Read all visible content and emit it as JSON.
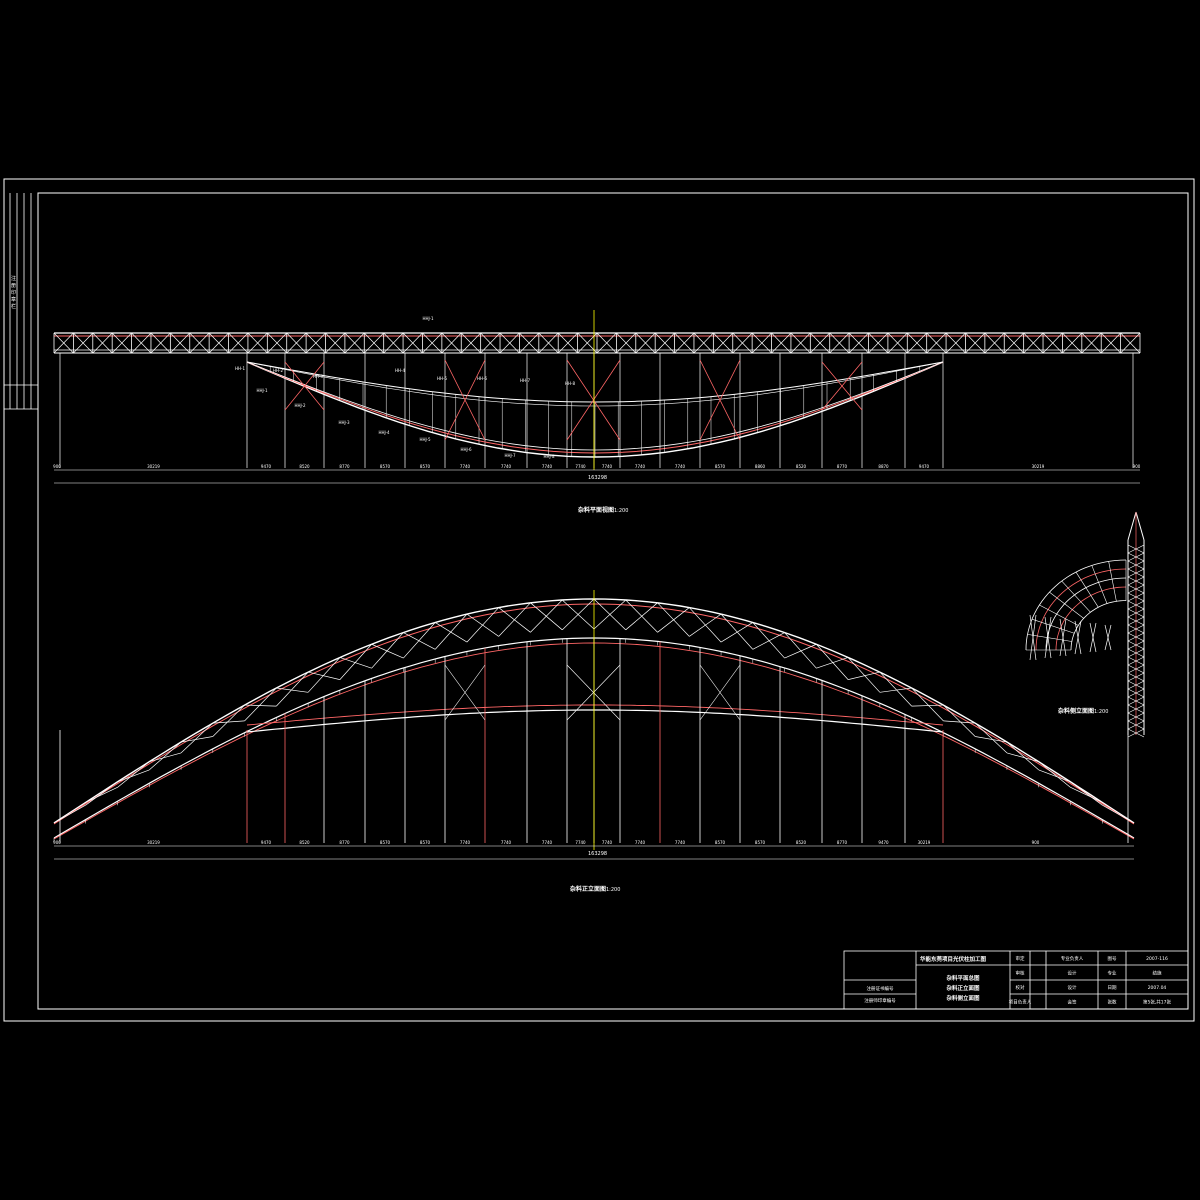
{
  "colors": {
    "background": "#000000",
    "line": "#ffffff",
    "chord": "#ff6666",
    "axis": "#ffff00"
  },
  "top_view": {
    "member_labels": [
      "HHJ-1",
      "HH-1",
      "HHJ-1",
      "HHJ-2",
      "HHJ-3",
      "HHJ-4",
      "HHJ-5",
      "HHJ-6",
      "HHJ-7",
      "HHJ-8",
      "HH-2",
      "HH-3",
      "HH-4",
      "HH-5",
      "HH-6",
      "HH-7",
      "HH-8"
    ],
    "dims": [
      "900",
      "30219",
      "9470",
      "8520",
      "8770",
      "8570",
      "8570",
      "7740",
      "7740",
      "7740",
      "7740",
      "7740",
      "7740",
      "7740",
      "8570",
      "8860",
      "8520",
      "8770",
      "8870",
      "9470",
      "30219",
      "900"
    ],
    "total": "163298",
    "title": "杂料平面视图",
    "scale": "1:200"
  },
  "front_view": {
    "dims": [
      "900",
      "30219",
      "9470",
      "8520",
      "8770",
      "8570",
      "8570",
      "7740",
      "7740",
      "7740",
      "7740",
      "7740",
      "7740",
      "7740",
      "8570",
      "8570",
      "8520",
      "8770",
      "9470",
      "30219",
      "900"
    ],
    "total": "163298",
    "title": "杂料正立面图",
    "scale": "1:200"
  },
  "side_view": {
    "title": "杂料侧立面图",
    "scale": "1:200"
  },
  "left_strip": {
    "labels": [
      "注",
      "册",
      "印",
      "章",
      "栏"
    ]
  },
  "title_block": {
    "project": "华能东莞项目光伏柱加工图",
    "drawing_titles": [
      "杂料平面总图",
      "杂料正立面图",
      "杂料侧立面图"
    ],
    "roles": [
      "审定",
      "审核",
      "校对",
      "项目负责人"
    ],
    "roles2": [
      "专业负责人",
      "设计",
      "设计",
      "会签"
    ],
    "fields": [
      "图号",
      "专业",
      "日期",
      "张数"
    ],
    "values": [
      "2007-116",
      "结施",
      "2007.04",
      "第5张,共17张"
    ],
    "left_labels": [
      "注册证书编号",
      "注册师印章编号"
    ]
  }
}
